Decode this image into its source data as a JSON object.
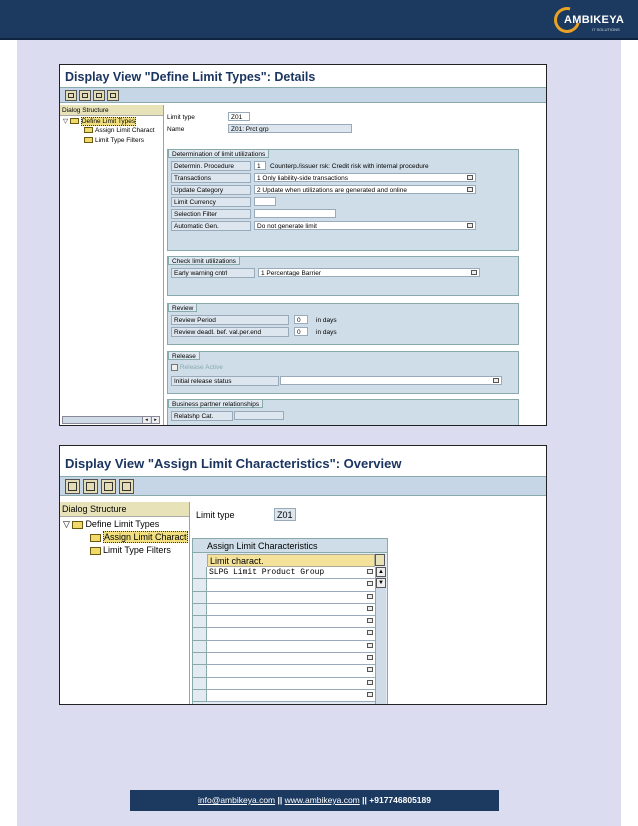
{
  "brand": {
    "name": "AMBIKEYA",
    "tagline": "IT SOLUTIONS"
  },
  "screen1": {
    "title": "Display View \"Define Limit Types\": Details",
    "dialog_structure": {
      "header": "Dialog Structure",
      "items": [
        "Define Limit Types",
        "Assign Limit Charact",
        "Limit Type Filters"
      ]
    },
    "limit_type": {
      "label": "Limit type",
      "value": "Z01"
    },
    "name": {
      "label": "Name",
      "value": "Z01: Prct grp"
    },
    "determination": {
      "title": "Determination of limit utilizations",
      "procedure": {
        "label": "Determin. Procedure",
        "value": "1",
        "desc": "Counterp./issuer rsk: Credit risk with internal procedure"
      },
      "transactions": {
        "label": "Transactions",
        "value": "1 Only liability-side transactions"
      },
      "update_category": {
        "label": "Update Category",
        "value": "2 Update when utilizations are generated and online"
      },
      "limit_currency": {
        "label": "Limit Currency",
        "value": ""
      },
      "selection_filter": {
        "label": "Selection Filter",
        "value": ""
      },
      "automatic_gen": {
        "label": "Automatic Gen.",
        "value": "Do not generate limit"
      }
    },
    "check": {
      "title": "Check limit utilizations",
      "early_warning": {
        "label": "Early warning cntrl",
        "value": "1 Percentage Barrier"
      }
    },
    "review": {
      "title": "Review",
      "period": {
        "label": "Review Period",
        "value": "0",
        "unit": "in days"
      },
      "deadline": {
        "label": "Review deadl. bef. val.per.end",
        "value": "0",
        "unit": "in days"
      }
    },
    "release": {
      "title": "Release",
      "active": "Release Active",
      "initial_status": {
        "label": "Initial release status",
        "value": ""
      }
    },
    "bp": {
      "title": "Business partner relationships",
      "cat": {
        "label": "Relatshp Cat.",
        "value": ""
      }
    }
  },
  "screen2": {
    "title": "Display View \"Assign Limit Characteristics\": Overview",
    "dialog_structure": {
      "header": "Dialog Structure",
      "items": [
        "Define Limit Types",
        "Assign Limit Charact",
        "Limit Type Filters"
      ]
    },
    "limit_type": {
      "label": "Limit type",
      "value": "Z01"
    },
    "table": {
      "title": "Assign Limit Characteristics",
      "column": "Limit charact.",
      "rows": [
        "SLPG Limit Product Group",
        "",
        "",
        "",
        "",
        "",
        "",
        "",
        "",
        "",
        "",
        ""
      ]
    }
  },
  "footer": {
    "email": "info@ambikeya.com",
    "sep1": "||",
    "site": "www.ambikeya.com",
    "sep2": "||",
    "phone": "+917746805189"
  }
}
